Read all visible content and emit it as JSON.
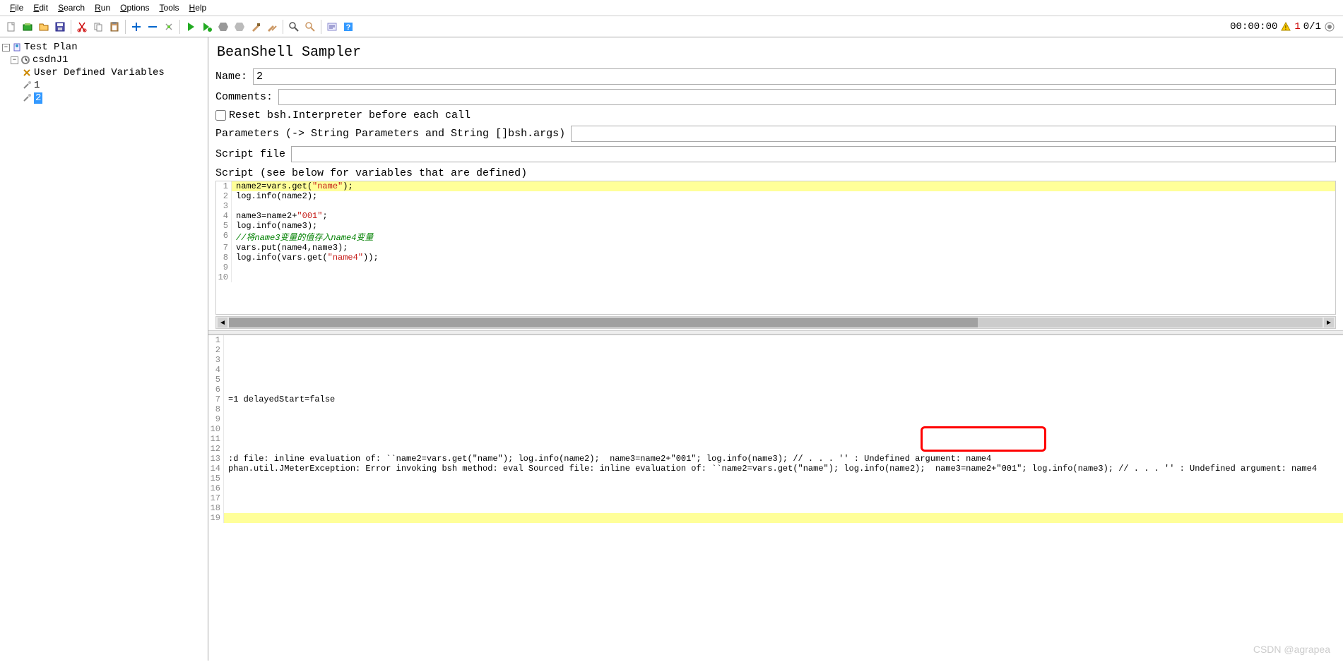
{
  "menu": {
    "file": "File",
    "edit": "Edit",
    "search": "Search",
    "run": "Run",
    "options": "Options",
    "tools": "Tools",
    "help": "Help"
  },
  "status": {
    "time": "00:00:00",
    "warn_count": "1",
    "active": "0/1"
  },
  "tree": {
    "root": "Test Plan",
    "tg": "csdnJ1",
    "udv": "User Defined Variables",
    "s1": "1",
    "s2": "2"
  },
  "panel": {
    "title": "BeanShell Sampler",
    "name_lbl": "Name:",
    "name_val": "2",
    "comments_lbl": "Comments:",
    "comments_val": "",
    "reset_lbl": "Reset bsh.Interpreter before each call",
    "params_lbl": "Parameters (-> String Parameters and String []bsh.args)",
    "params_val": "",
    "scriptfile_lbl": "Script file",
    "scriptfile_val": "",
    "script_lbl": "Script (see below for variables that are defined)"
  },
  "script_lines": [
    {
      "n": "1",
      "pre": "name2=vars.get(",
      "str": "\"name\"",
      "post": ");",
      "hl": true
    },
    {
      "n": "2",
      "plain": "log.info(name2);"
    },
    {
      "n": "3",
      "plain": ""
    },
    {
      "n": "4",
      "pre": "name3=name2+",
      "str": "\"001\"",
      "post": ";"
    },
    {
      "n": "5",
      "plain": "log.info(name3);"
    },
    {
      "n": "6",
      "cmt": "//将name3变量的值存入name4变量"
    },
    {
      "n": "7",
      "plain": "vars.put(name4,name3);"
    },
    {
      "n": "8",
      "pre": "log.info(vars.get(",
      "str": "\"name4\"",
      "post": "));"
    },
    {
      "n": "9",
      "plain": ""
    },
    {
      "n": "10",
      "plain": ""
    }
  ],
  "log_lines": [
    {
      "n": "1",
      "t": ""
    },
    {
      "n": "2",
      "t": ""
    },
    {
      "n": "3",
      "t": ""
    },
    {
      "n": "4",
      "t": ""
    },
    {
      "n": "5",
      "t": ""
    },
    {
      "n": "6",
      "t": ""
    },
    {
      "n": "7",
      "t": "=1 delayedStart=false"
    },
    {
      "n": "8",
      "t": ""
    },
    {
      "n": "9",
      "t": ""
    },
    {
      "n": "10",
      "t": ""
    },
    {
      "n": "11",
      "t": ""
    },
    {
      "n": "12",
      "t": ""
    },
    {
      "n": "13",
      "t": ":d file: inline evaluation of: ``name2=vars.get(\"name\"); log.info(name2);  name3=name2+\"001\"; log.info(name3); // . . . '' : Undefined argument: name4"
    },
    {
      "n": "14",
      "t": "phan.util.JMeterException: Error invoking bsh method: eval Sourced file: inline evaluation of: ``name2=vars.get(\"name\"); log.info(name2);  name3=name2+\"001\"; log.info(name3); // . . . '' : Undefined argument: name4"
    },
    {
      "n": "15",
      "t": ""
    },
    {
      "n": "16",
      "t": ""
    },
    {
      "n": "17",
      "t": ""
    },
    {
      "n": "18",
      "t": ""
    },
    {
      "n": "19",
      "t": "",
      "hl": true
    }
  ],
  "watermark": "CSDN @agrapea"
}
